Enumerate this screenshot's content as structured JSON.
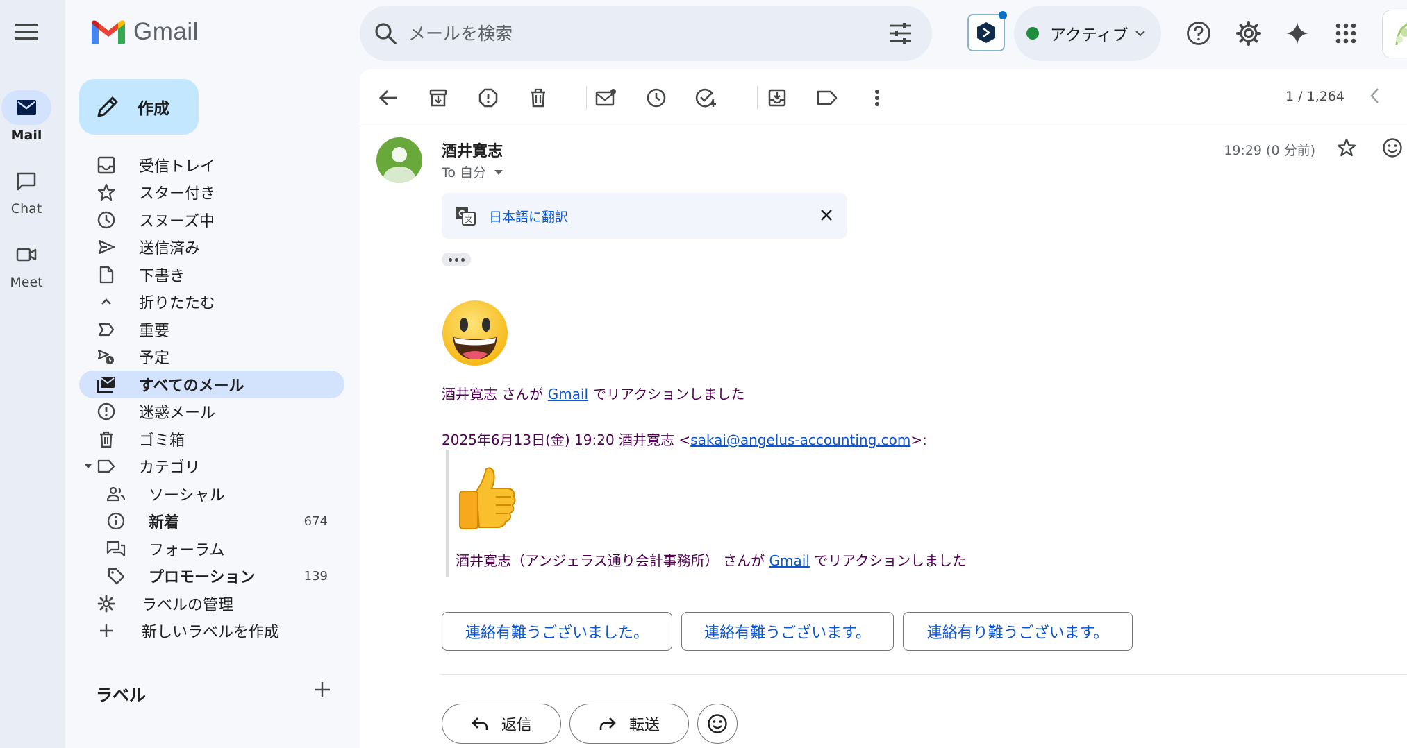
{
  "rail": {
    "mail_label": "Mail",
    "chat_label": "Chat",
    "meet_label": "Meet"
  },
  "brand": {
    "name": "Gmail"
  },
  "compose": {
    "label": "作成"
  },
  "nav": {
    "inbox": "受信トレイ",
    "starred": "スター付き",
    "snoozed": "スヌーズ中",
    "sent": "送信済み",
    "drafts": "下書き",
    "collapse": "折りたたむ",
    "important": "重要",
    "scheduled": "予定",
    "all_mail": "すべてのメール",
    "spam": "迷惑メール",
    "trash": "ゴミ箱",
    "categories": "カテゴリ",
    "social": "ソーシャル",
    "updates": "新着",
    "updates_count": "674",
    "forums": "フォーラム",
    "promotions": "プロモーション",
    "promotions_count": "139",
    "manage_labels": "ラベルの管理",
    "create_label": "新しいラベルを作成"
  },
  "labels": {
    "header": "ラベル"
  },
  "search": {
    "placeholder": "メールを検索"
  },
  "status": {
    "label": "アクティブ"
  },
  "toolbar": {
    "pager": "1 / 1,264"
  },
  "message": {
    "sender_name": "酒井寛志",
    "to": "To 自分",
    "time": "19:29 (0 分前)",
    "translate": "日本語に翻訳",
    "reaction_name": "酒井寛志",
    "reaction_mid": " さんが ",
    "reaction_link": "Gmail",
    "reaction_end": " でリアクションしました",
    "quote_header_pre": "2025年6月13日(金) 19:20 酒井寛志 <",
    "quote_email": "sakai@angelus-accounting.com",
    "quote_header_post": ">:",
    "quote_name": "酒井寛志（アンジェラス通り会計事務所）",
    "quote_mid": " さんが ",
    "quote_link": "Gmail",
    "quote_end": " でリアクションしました"
  },
  "smart_replies": [
    "連絡有難うございました。",
    "連絡有難うございます。",
    "連絡有り難うございます。"
  ],
  "actions": {
    "reply": "返信",
    "forward": "転送"
  }
}
